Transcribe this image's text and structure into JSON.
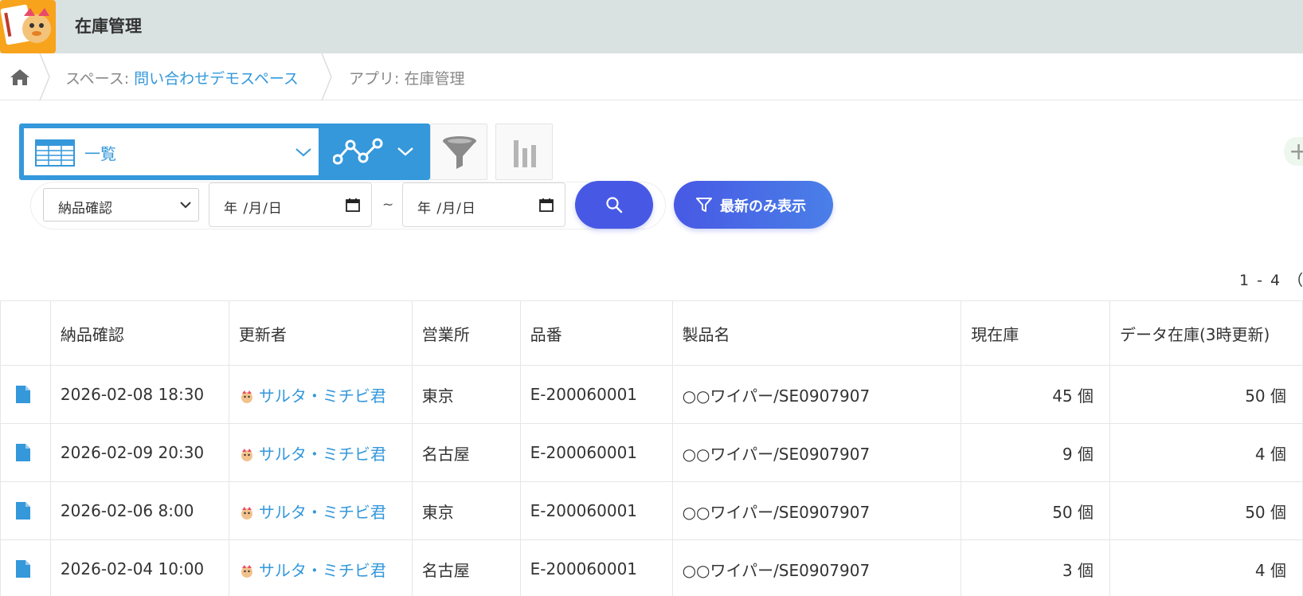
{
  "header": {
    "app_title": "在庫管理"
  },
  "breadcrumb": {
    "space_prefix": "スペース: ",
    "space_name": "問い合わせデモスペース",
    "app_prefix": "アプリ: ",
    "app_name": "在庫管理"
  },
  "view": {
    "current_view": "一覧"
  },
  "filter": {
    "field_selected": "納品確認",
    "date_from_placeholder": "年 /月/日",
    "date_to_placeholder": "年 /月/日",
    "range_separator": "~",
    "latest_only_label": "最新のみ表示"
  },
  "pager": {
    "range_text": "1 - 4 （"
  },
  "table": {
    "headers": [
      "納品確認",
      "更新者",
      "営業所",
      "品番",
      "製品名",
      "現在庫",
      "データ在庫(3時更新)"
    ],
    "rows": [
      {
        "delivery": "2026-02-08 18:30",
        "updater": "サルタ・ミチビ君",
        "office": "東京",
        "part_no": "E-200060001",
        "product": "○○ワイパー/SE0907907",
        "stock": "45 個",
        "data_stock": "50 個"
      },
      {
        "delivery": "2026-02-09 20:30",
        "updater": "サルタ・ミチビ君",
        "office": "名古屋",
        "part_no": "E-200060001",
        "product": "○○ワイパー/SE0907907",
        "stock": "9 個",
        "data_stock": "4 個"
      },
      {
        "delivery": "2026-02-06 8:00",
        "updater": "サルタ・ミチビ君",
        "office": "東京",
        "part_no": "E-200060001",
        "product": "○○ワイパー/SE0907907",
        "stock": "50 個",
        "data_stock": "50 個"
      },
      {
        "delivery": "2026-02-04 10:00",
        "updater": "サルタ・ミチビ君",
        "office": "名古屋",
        "part_no": "E-200060001",
        "product": "○○ワイパー/SE0907907",
        "stock": "3 個",
        "data_stock": "4 個"
      }
    ]
  },
  "icons": {
    "home": "home-icon",
    "table_view": "table-view-icon",
    "graph": "graph-icon",
    "filter": "funnel-icon",
    "aggregate": "bar-chart-icon",
    "search": "search-icon",
    "calendar": "calendar-icon",
    "record": "document-icon",
    "add": "plus-icon"
  },
  "colors": {
    "header_bg": "#d9e1e1",
    "accent_blue": "#3498db",
    "button_indigo": "#4759e4",
    "logo_orange": "#f7a31c"
  }
}
